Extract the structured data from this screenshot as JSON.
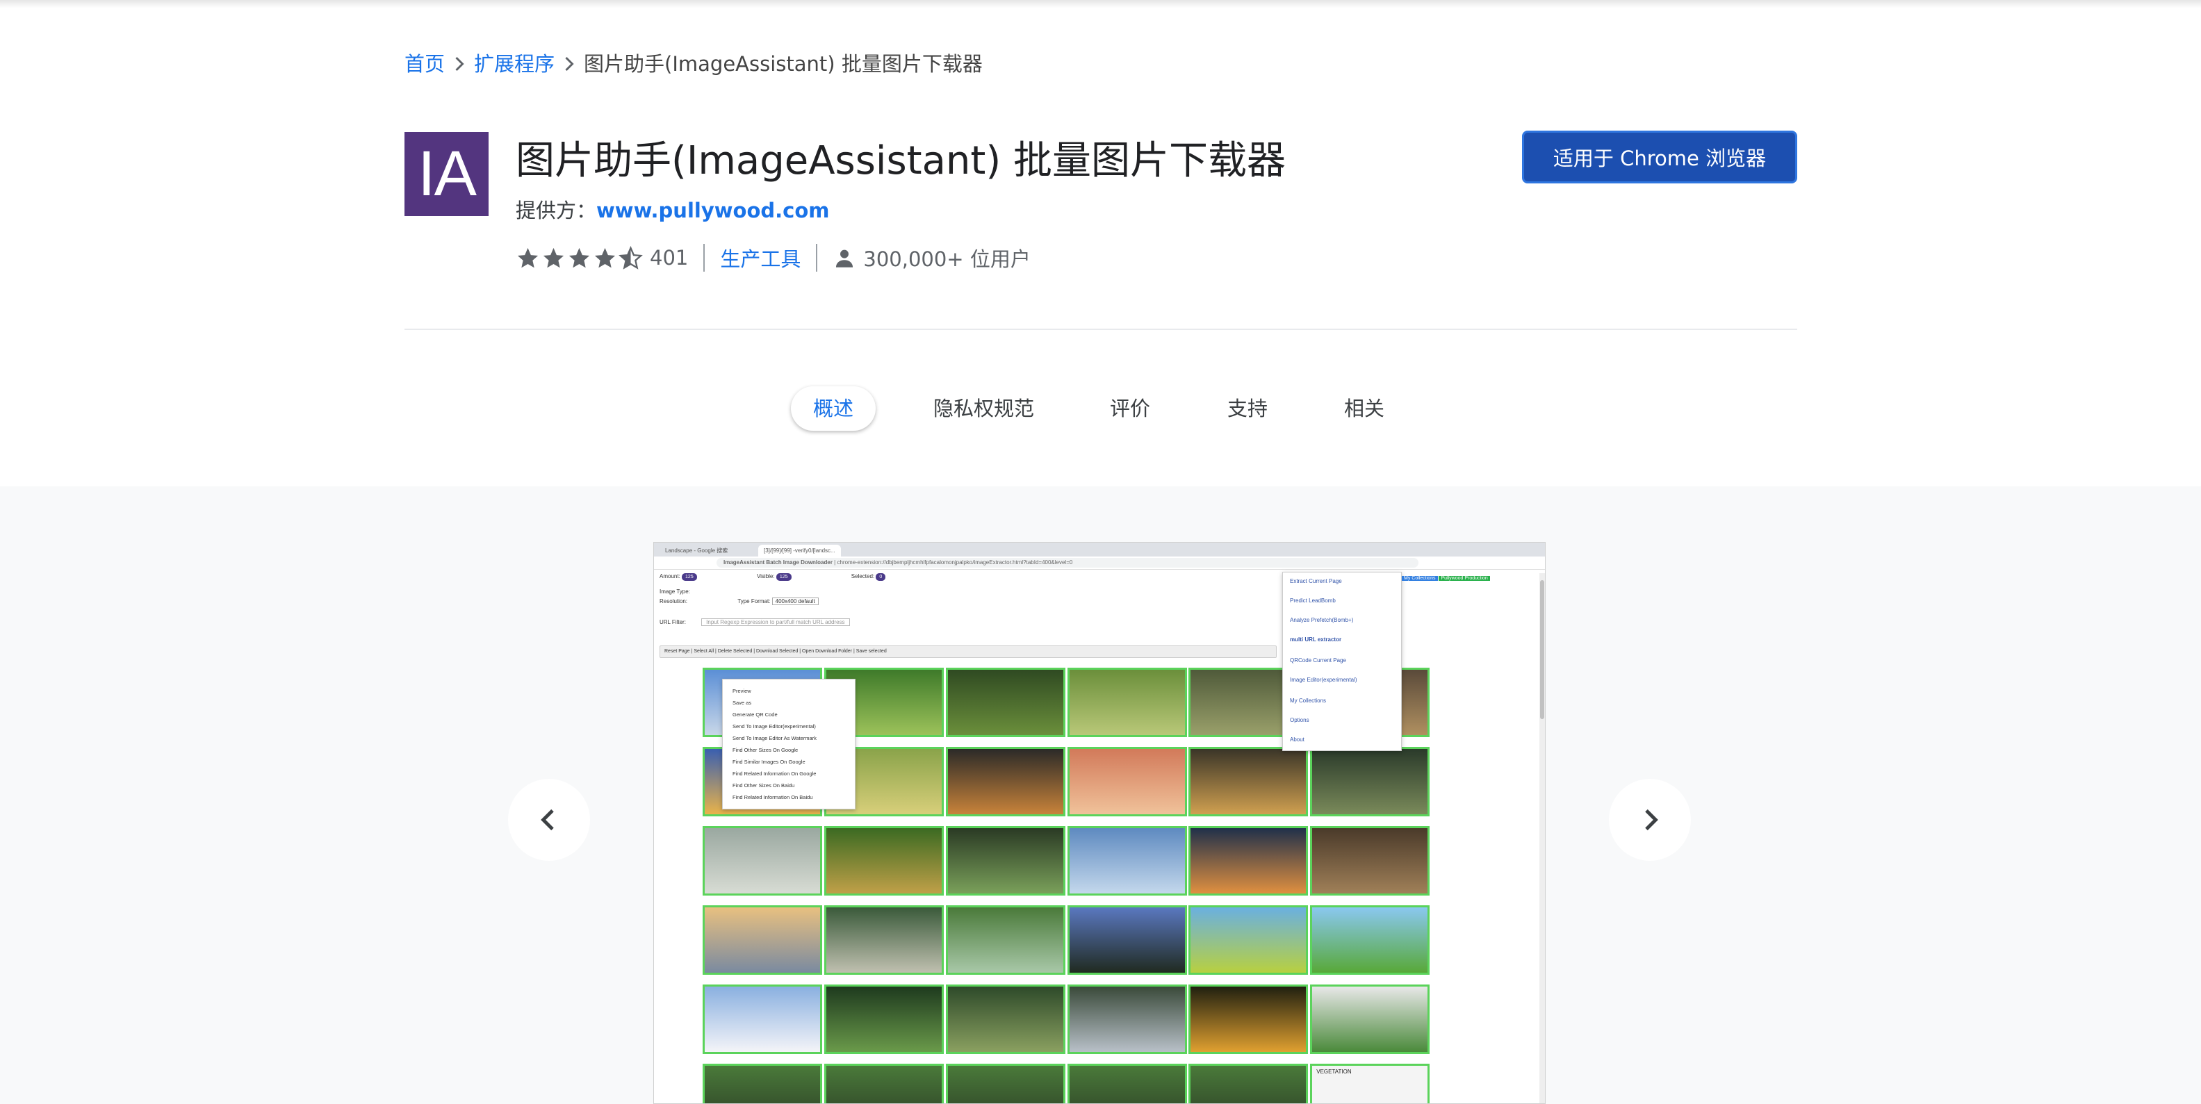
{
  "breadcrumb": {
    "home": "首页",
    "extensions": "扩展程序",
    "current": "图片助手(ImageAssistant) 批量图片下载器"
  },
  "extension": {
    "logo_text": "IA",
    "title": "图片助手(ImageAssistant) 批量图片下载器",
    "provider_label": "提供方：",
    "provider_link": "www.pullywood.com",
    "rating": 4.5,
    "rating_count": "401",
    "category": "生产工具",
    "users": "300,000+ 位用户"
  },
  "install_button": "适用于 Chrome 浏览器",
  "tabs": [
    {
      "label": "概述",
      "active": true
    },
    {
      "label": "隐私权规范",
      "active": false
    },
    {
      "label": "评价",
      "active": false
    },
    {
      "label": "支持",
      "active": false
    },
    {
      "label": "相关",
      "active": false
    }
  ],
  "gallery": {
    "prev_icon": "chevron-left-icon",
    "next_icon": "chevron-right-icon"
  },
  "screenshot": {
    "tab1": "Landscape - Google 搜索",
    "tab2": "[3]/[99]/[99] -verify0/[landsc...",
    "addr_prefix": "ImageAssistant Batch Image Downloader",
    "url": "chrome-extension://dbjbempljhcmhlfpfacalomonjpalpko/imageExtractor.html?tabId=400&level=0",
    "amount_label": "Amount:",
    "amount_value": "125",
    "visible_label": "Visible:",
    "visible_value": "125",
    "selected_label": "Selected:",
    "selected_value": "0",
    "image_type_label": "Image Type:",
    "resolution_label": "Resolution:",
    "type_format_label": "Type Format:",
    "type_format_value": "400x400 default",
    "url_filter_label": "URL Filter:",
    "url_filter_placeholder": "Input Regexp Expression to part/full match URL address",
    "toolbar_items": [
      "Reset Page",
      "Select All",
      "Delete Selected",
      "Download Selected",
      "Open Download Folder",
      "Save selected"
    ],
    "menu_items": [
      "Extract Current Page",
      "Predict LeadBomb",
      "Analyze Prefetch(Bomb+)",
      "multi URL extractor",
      "QRCode Current Page",
      "Image Editor(experimental)",
      "My Collections",
      "Options",
      "About"
    ],
    "context_items": [
      "Preview",
      "Save as",
      "Generate QR Code",
      "Send To Image Editor(experimental)",
      "Send To Image Editor As Watermark",
      "Find Other Sizes On Google",
      "Find Similar Images On Google",
      "Find Related Information On Google",
      "Find Other Sizes On Baidu",
      "Find Related Information On Baidu"
    ],
    "collection_labels": [
      "My Collections",
      "Pullywood Production"
    ],
    "thumbnail_label": "VEGETATION"
  },
  "colors": {
    "brand_link": "#1a73e8",
    "install_bg": "#1c4fb0",
    "logo_bg": "#53357f",
    "thumb_border": "#5bd35b"
  }
}
